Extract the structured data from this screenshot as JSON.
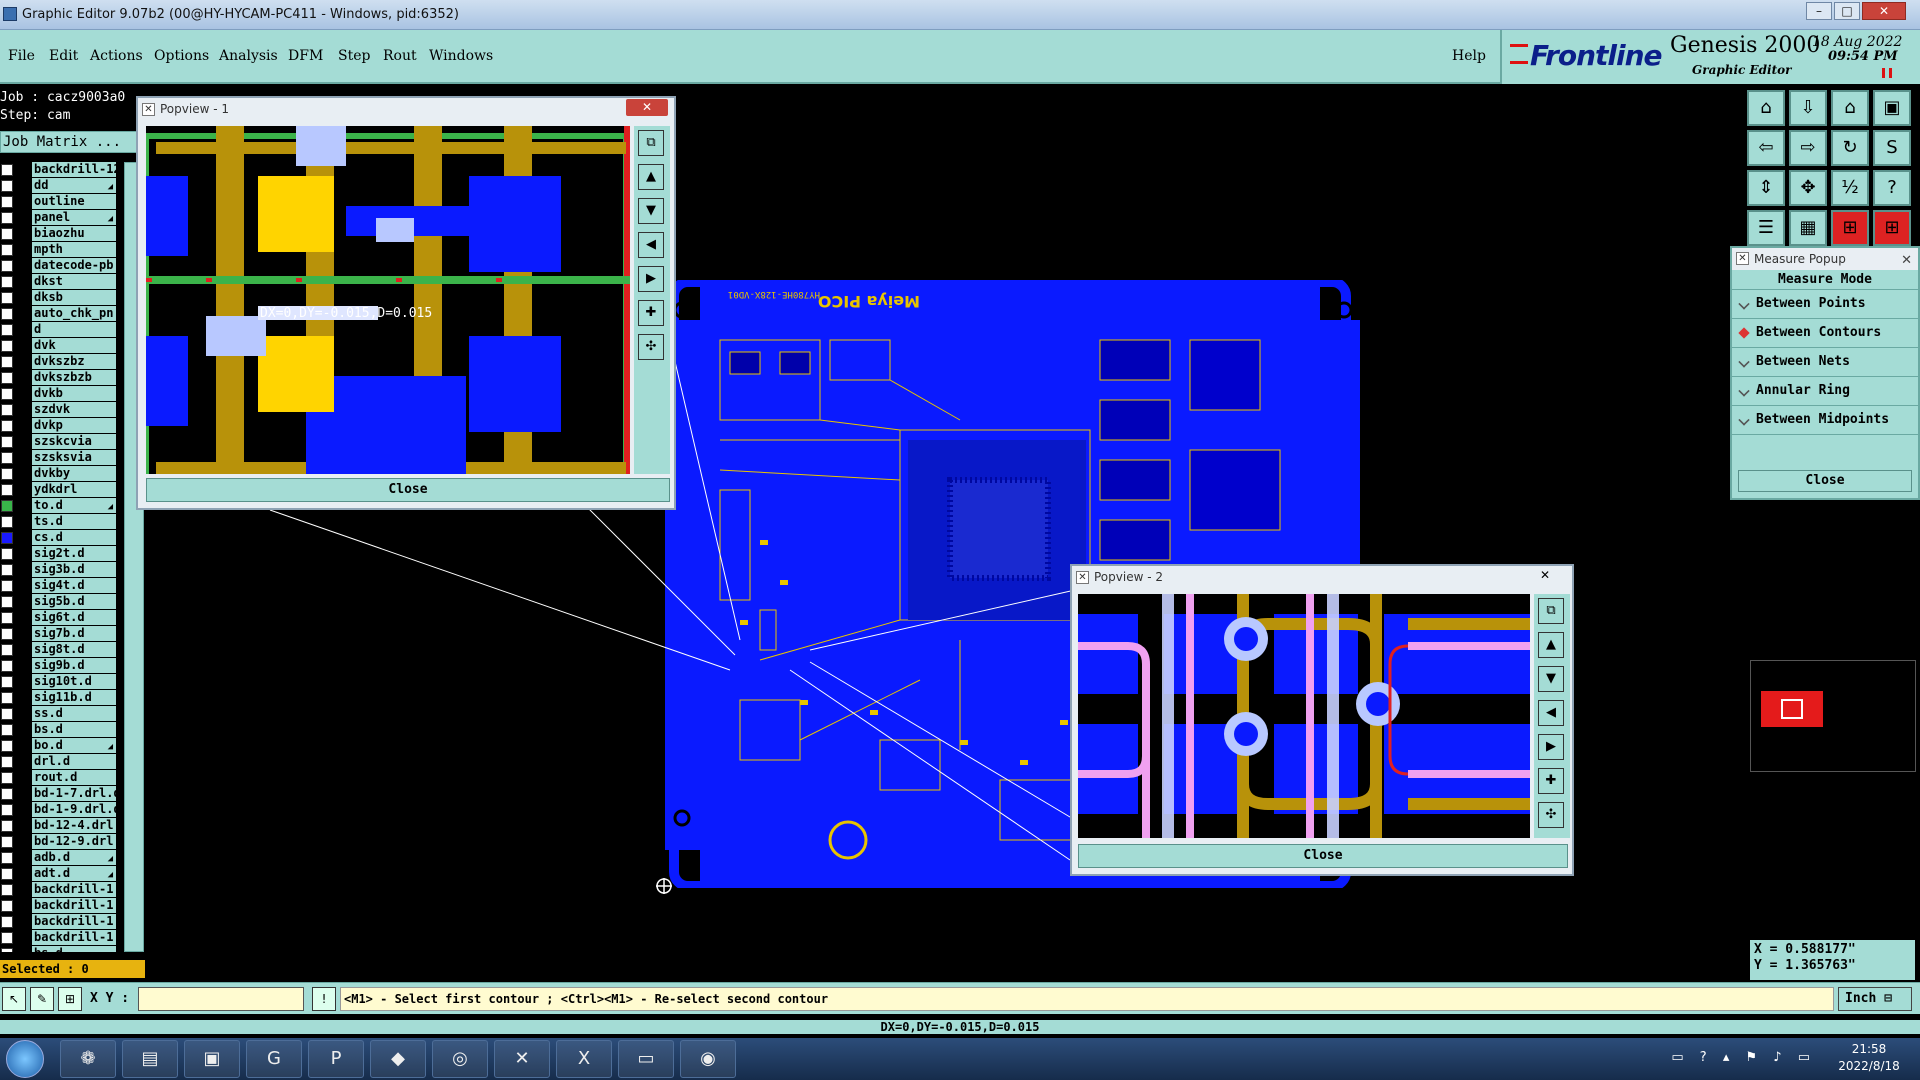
{
  "window": {
    "title": "Graphic Editor 9.07b2 (00@HY-HYCAM-PC411 - Windows, pid:6352)",
    "min_label": "–",
    "max_label": "□",
    "close_label": "✕"
  },
  "menu": {
    "items": [
      "File",
      "Edit",
      "Actions",
      "Options",
      "Analysis",
      "DFM",
      "Step",
      "Rout",
      "Windows"
    ],
    "help": "Help"
  },
  "brand": {
    "logo": "Frontline",
    "product": "Genesis 2000",
    "subtitle": "Graphic Editor",
    "date": "18 Aug 2022",
    "time": "09:54 PM"
  },
  "job": {
    "job_line": "Job : cacz9003a0",
    "step_line": "Step: cam",
    "matrix_label": "Job Matrix ...",
    "selected": "Selected : 0"
  },
  "layers": [
    {
      "name": "backdrill-12",
      "chk": "white",
      "arrow": false
    },
    {
      "name": "dd",
      "chk": "white",
      "arrow": true
    },
    {
      "name": "outline",
      "chk": "white",
      "arrow": false
    },
    {
      "name": "panel",
      "chk": "white",
      "arrow": true
    },
    {
      "name": "biaozhu",
      "chk": "white",
      "arrow": false
    },
    {
      "name": "mpth",
      "chk": "white",
      "arrow": false
    },
    {
      "name": "datecode-pb",
      "chk": "white",
      "arrow": false
    },
    {
      "name": "dkst",
      "chk": "white",
      "arrow": false
    },
    {
      "name": "dksb",
      "chk": "white",
      "arrow": false
    },
    {
      "name": "auto_chk_pn",
      "chk": "white",
      "arrow": false
    },
    {
      "name": "d",
      "chk": "white",
      "arrow": false
    },
    {
      "name": "dvk",
      "chk": "white",
      "arrow": false
    },
    {
      "name": "dvkszbz",
      "chk": "white",
      "arrow": false
    },
    {
      "name": "dvkszbzb",
      "chk": "white",
      "arrow": false
    },
    {
      "name": "dvkb",
      "chk": "white",
      "arrow": false
    },
    {
      "name": "szdvk",
      "chk": "white",
      "arrow": false
    },
    {
      "name": "dvkp",
      "chk": "white",
      "arrow": false
    },
    {
      "name": "szskcvia",
      "chk": "white",
      "arrow": false
    },
    {
      "name": "szsksvia",
      "chk": "white",
      "arrow": false
    },
    {
      "name": "dvkby",
      "chk": "white",
      "arrow": false
    },
    {
      "name": "ydkdrl",
      "chk": "white",
      "arrow": false
    },
    {
      "name": "to.d",
      "chk": "green",
      "arrow": true
    },
    {
      "name": "ts.d",
      "chk": "white",
      "arrow": false
    },
    {
      "name": "cs.d",
      "chk": "blue",
      "arrow": false
    },
    {
      "name": "sig2t.d",
      "chk": "white",
      "arrow": false
    },
    {
      "name": "sig3b.d",
      "chk": "white",
      "arrow": false
    },
    {
      "name": "sig4t.d",
      "chk": "white",
      "arrow": false
    },
    {
      "name": "sig5b.d",
      "chk": "white",
      "arrow": false
    },
    {
      "name": "sig6t.d",
      "chk": "white",
      "arrow": false
    },
    {
      "name": "sig7b.d",
      "chk": "white",
      "arrow": false
    },
    {
      "name": "sig8t.d",
      "chk": "white",
      "arrow": false
    },
    {
      "name": "sig9b.d",
      "chk": "white",
      "arrow": false
    },
    {
      "name": "sig10t.d",
      "chk": "white",
      "arrow": false
    },
    {
      "name": "sig11b.d",
      "chk": "white",
      "arrow": false
    },
    {
      "name": "ss.d",
      "chk": "white",
      "arrow": false
    },
    {
      "name": "bs.d",
      "chk": "white",
      "arrow": false
    },
    {
      "name": "bo.d",
      "chk": "white",
      "arrow": true
    },
    {
      "name": "drl.d",
      "chk": "white",
      "arrow": false
    },
    {
      "name": "rout.d",
      "chk": "white",
      "arrow": false
    },
    {
      "name": "bd-1-7.drl.d",
      "chk": "white",
      "arrow": false
    },
    {
      "name": "bd-1-9.drl.d",
      "chk": "white",
      "arrow": false
    },
    {
      "name": "bd-12-4.drl",
      "chk": "white",
      "arrow": false
    },
    {
      "name": "bd-12-9.drl",
      "chk": "white",
      "arrow": false
    },
    {
      "name": "adb.d",
      "chk": "white",
      "arrow": true
    },
    {
      "name": "adt.d",
      "chk": "white",
      "arrow": true
    },
    {
      "name": "backdrill-1",
      "chk": "white",
      "arrow": false
    },
    {
      "name": "backdrill-1",
      "chk": "white",
      "arrow": false
    },
    {
      "name": "backdrill-1",
      "chk": "white",
      "arrow": false
    },
    {
      "name": "backdrill-1",
      "chk": "white",
      "arrow": false
    },
    {
      "name": "bs.d",
      "chk": "white",
      "arrow": false
    }
  ],
  "popup1": {
    "title": "Popview - 1",
    "measure_text": "DX=0,DY=-0.015,D=0.015",
    "close": "Close",
    "close_x": "✕"
  },
  "popup2": {
    "title": "Popview - 2",
    "close": "Close",
    "close_x": "✕"
  },
  "measure_popup": {
    "title": "Measure Popup",
    "mode_label": "Measure Mode",
    "options": [
      "Between Points",
      "Between Contours",
      "Between Nets",
      "Annular Ring",
      "Between Midpoints"
    ],
    "selected_index": 1,
    "close": "Close",
    "close_x": "✕"
  },
  "coords": {
    "x": "X = 0.588177\"",
    "y": "Y = 1.365763\""
  },
  "cmd": {
    "xy_label": "X Y :",
    "xy_value": "",
    "prompt": "<M1> - Select first contour ; <Ctrl><M1> - Re-select second contour",
    "unit": "Inch ⊟",
    "status": "DX=0,DY=-0.015,D=0.015"
  },
  "pcb": {
    "silk_title": "Meiya PICO",
    "silk_part": "HY780HE-128X-VD01"
  },
  "taskbar": {
    "time": "21:58",
    "date": "2022/8/18"
  },
  "colors": {
    "panel": "#a4dcd5",
    "pcb_copper": "#0a1aff",
    "pad_yellow": "#ffd400",
    "trace_gold": "#b8920a",
    "outline_green": "#3bb34a"
  }
}
